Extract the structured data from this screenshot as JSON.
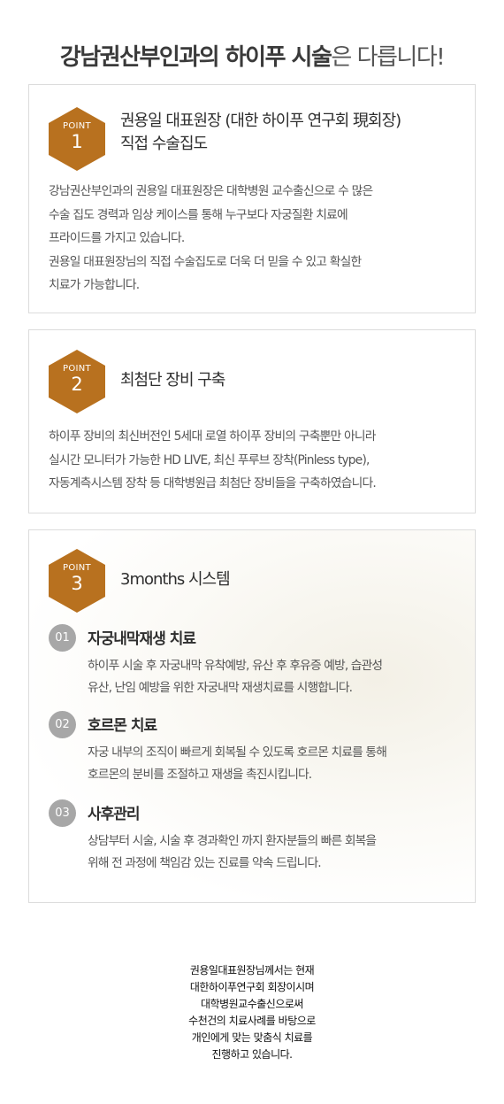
{
  "headline": {
    "strong": "강남권산부인과의 하이푸 시술",
    "light": "은 다릅니다!"
  },
  "points": [
    {
      "badge_label": "POINT",
      "badge_number": "1",
      "title_lines": [
        "권용일 대표원장 (대한 하이푸 연구회 現회장)",
        "직접 수술집도"
      ],
      "body_lines": [
        "강남권산부인과의 권용일 대표원장은 대학병원 교수출신으로 수 많은",
        "수술 집도 경력과 임상 케이스를 통해 누구보다 자궁질환 치료에",
        "프라이드를 가지고 있습니다.",
        "권용일 대표원장님의 직접 수술집도로 더욱 더 믿을 수 있고 확실한",
        "치료가 가능합니다."
      ]
    },
    {
      "badge_label": "POINT",
      "badge_number": "2",
      "title_lines": [
        "최첨단 장비 구축"
      ],
      "body_lines": [
        "하이푸 장비의 최신버전인 5세대 로열 하이푸 장비의 구축뿐만 아니라",
        "실시간 모니터가 가능한 HD LIVE, 최신 푸루브 장착(Pinless type),",
        "자동계측시스템 장착 등 대학병원급 최첨단 장비들을 구축하였습니다."
      ]
    },
    {
      "badge_label": "POINT",
      "badge_number": "3",
      "title_lines": [
        "3months 시스템"
      ],
      "subsections": [
        {
          "number": "01",
          "title": "자궁내막재생 치료",
          "body_lines": [
            "하이푸 시술 후 자궁내막 유착예방, 유산 후 후유증 예방, 습관성",
            "유산, 난임 예방을 위한 자궁내막 재생치료를 시행합니다."
          ]
        },
        {
          "number": "02",
          "title": "호르몬 치료",
          "body_lines": [
            "자궁 내부의 조직이 빠르게 회복될 수 있도록 호르몬 치료를 통해",
            "호르몬의 분비를 조절하고 재생을 촉진시킵니다."
          ]
        },
        {
          "number": "03",
          "title": "사후관리",
          "body_lines": [
            "상담부터 시술, 시술 후 경과확인 까지 환자분들의 빠른 회복을",
            "위해 전 과정에 책임감 있는 진료를 약속 드립니다."
          ]
        }
      ]
    }
  ],
  "footer_lines": [
    "권용일대표원장님께서는 현재",
    "대한하이푸연구회 회장이시며",
    "대학병원교수출신으로써",
    "수천건의 치료사례를 바탕으로",
    "개인에게 맞는 맞춤식 치료를",
    "진행하고 있습니다."
  ],
  "colors": {
    "badge": "#b8711f",
    "sub_circle": "#a7a7a7",
    "border": "#dcdcdc"
  }
}
